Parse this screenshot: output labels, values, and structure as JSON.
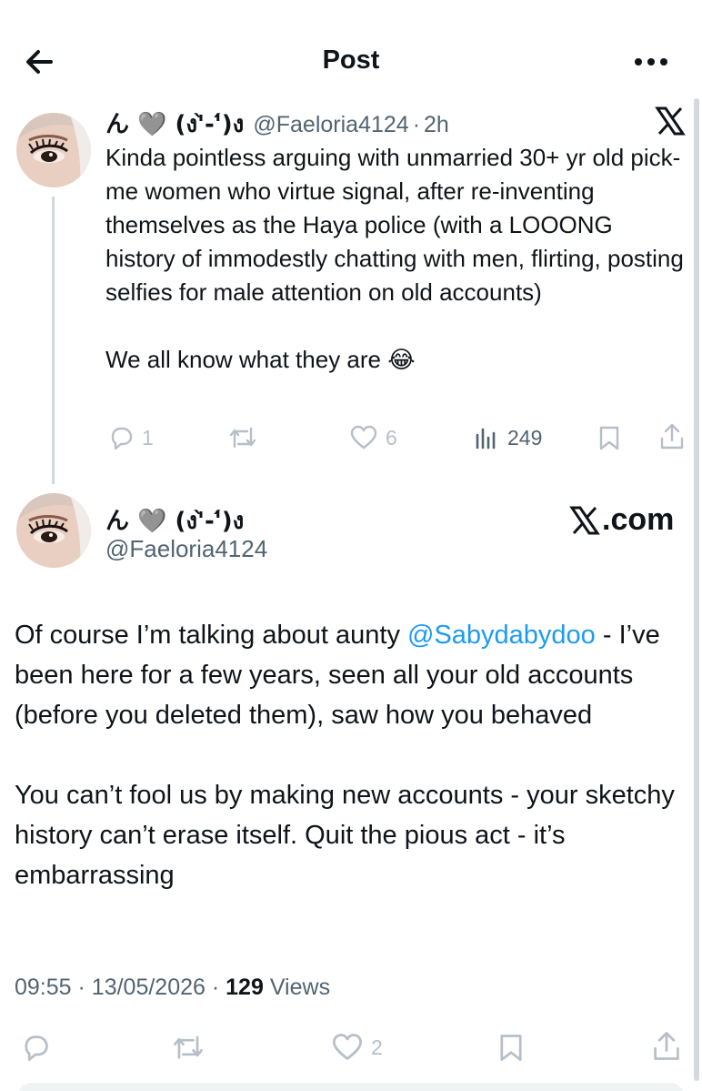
{
  "header": {
    "title": "Post",
    "back_icon": "arrow-left-icon",
    "more_icon": "more-horizontal-icon"
  },
  "quoted_post": {
    "display_name": "ん 🩶 (ง'̀-'́)ง",
    "handle": "@Faeloria4124",
    "separator": "·",
    "time": "2h",
    "paragraphs": [
      "Kinda pointless arguing with unmarried 30+ yr old pick-me women who virtue signal, after re-inventing themselves as the Haya police (with a LOOONG history of immodestly chatting with men, flirting, posting selfies for male attention on old accounts)",
      "We all know what they are 😂"
    ],
    "stats": {
      "replies": "1",
      "reposts": "",
      "likes": "6",
      "views": "249"
    }
  },
  "main_post": {
    "display_name": "ん 🩶 (ง'̀-'́)ง",
    "handle": "@Faeloria4124",
    "source": ".com",
    "paragraph1_before": "Of course I’m talking about aunty ",
    "mention": "@Sabydabydoo",
    "paragraph1_after": " - I’ve been here for a few years, seen all your old accounts (before you deleted them), saw how you behaved",
    "paragraph2": "You can’t fool us by making new accounts - your sketchy history can’t erase itself. Quit the pious act - it’s embarrassing",
    "time": "09:55",
    "separator": "·",
    "date": "13/05/2026",
    "views_count": "129",
    "views_label": "Views",
    "stats": {
      "likes": "2"
    }
  },
  "colors": {
    "accent": "#1d9bf0",
    "text": "#0f1419",
    "muted": "#536471",
    "icon": "#b6bfc7"
  }
}
